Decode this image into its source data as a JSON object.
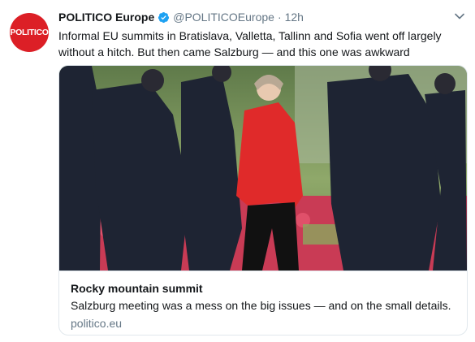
{
  "tweet": {
    "avatar_text": "POLITICO",
    "display_name": "POLITICO Europe",
    "handle": "@POLITICOEurope",
    "separator": "·",
    "time": "12h",
    "text": "Informal EU summits in Bratislava, Valletta, Tallinn and Sofia went off largely without a hitch. But then came Salzburg — and this one was awkward"
  },
  "card": {
    "title": "Rocky mountain summit",
    "description": "Salzburg meeting was a mess on the big issues — and on the small details.",
    "domain": "politico.eu"
  },
  "colors": {
    "brand_red": "#dc1f26",
    "verified_blue": "#1da1f2",
    "muted": "#657786"
  },
  "icons": [
    "verified-badge-icon",
    "chevron-down-icon"
  ]
}
